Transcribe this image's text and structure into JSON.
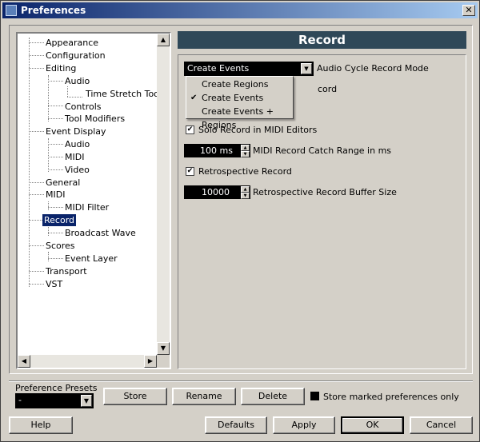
{
  "window": {
    "title": "Preferences"
  },
  "tree": {
    "items": [
      {
        "label": "Appearance"
      },
      {
        "label": "Configuration"
      },
      {
        "label": "Editing"
      },
      {
        "label": "Audio"
      },
      {
        "label": "Time Stretch Tool"
      },
      {
        "label": "Controls"
      },
      {
        "label": "Tool Modifiers"
      },
      {
        "label": "Event Display"
      },
      {
        "label": "Audio"
      },
      {
        "label": "MIDI"
      },
      {
        "label": "Video"
      },
      {
        "label": "General"
      },
      {
        "label": "MIDI"
      },
      {
        "label": "MIDI Filter"
      },
      {
        "label": "Record"
      },
      {
        "label": "Broadcast Wave"
      },
      {
        "label": "Scores"
      },
      {
        "label": "Event Layer"
      },
      {
        "label": "Transport"
      },
      {
        "label": "VST"
      }
    ]
  },
  "panel": {
    "title": "Record",
    "audio_cycle": {
      "selected": "Create Events",
      "label": "Audio Cycle Record Mode"
    },
    "dropdown_options": [
      "Create Regions",
      "Create Events",
      "Create Events + Regions"
    ],
    "partial_label": "cord",
    "solo_record": {
      "label": "Solo Record in MIDI Editors",
      "checked": true
    },
    "catch_range": {
      "value": "100 ms",
      "label": "MIDI Record Catch Range in ms"
    },
    "retro_record": {
      "label": "Retrospective Record",
      "checked": true
    },
    "retro_buffer": {
      "value": "10000",
      "label": "Retrospective Record Buffer Size"
    }
  },
  "presets": {
    "label": "Preference Presets",
    "value": "-",
    "store": "Store",
    "rename": "Rename",
    "delete": "Delete",
    "store_marked": "Store marked preferences only"
  },
  "footer": {
    "help": "Help",
    "defaults": "Defaults",
    "apply": "Apply",
    "ok": "OK",
    "cancel": "Cancel"
  }
}
